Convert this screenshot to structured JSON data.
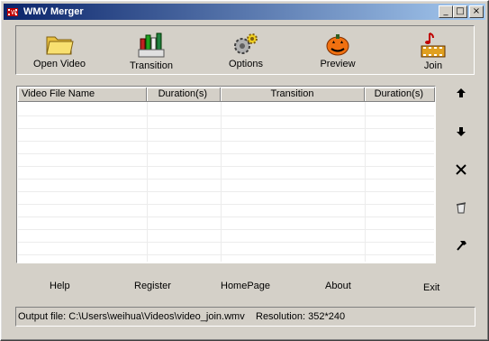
{
  "window": {
    "title": "WMV Merger",
    "icon": "film-reel-icon"
  },
  "titlebar_buttons": {
    "minimize": "_",
    "maximize": "□",
    "close": "×"
  },
  "toolbar": {
    "open_video": "Open Video",
    "transition": "Transition",
    "options": "Options",
    "preview": "Preview",
    "join": "Join"
  },
  "table": {
    "columns": [
      "Video File Name",
      "Duration(s)",
      "Transition",
      "Duration(s)"
    ],
    "rows": []
  },
  "side_buttons": [
    "move-up-icon",
    "move-down-icon",
    "delete-icon",
    "clear-all-icon",
    "tools-icon"
  ],
  "bottom": {
    "help": "Help",
    "register": "Register",
    "homepage": "HomePage",
    "about": "About",
    "exit": "Exit"
  },
  "status": {
    "output_file": "Output file: C:\\Users\\weihua\\Videos\\video_join.wmv",
    "resolution": "Resolution: 352*240"
  },
  "colors": {
    "titlebar_start": "#0a246a",
    "titlebar_end": "#a6caf0",
    "face": "#d4d0c8"
  }
}
